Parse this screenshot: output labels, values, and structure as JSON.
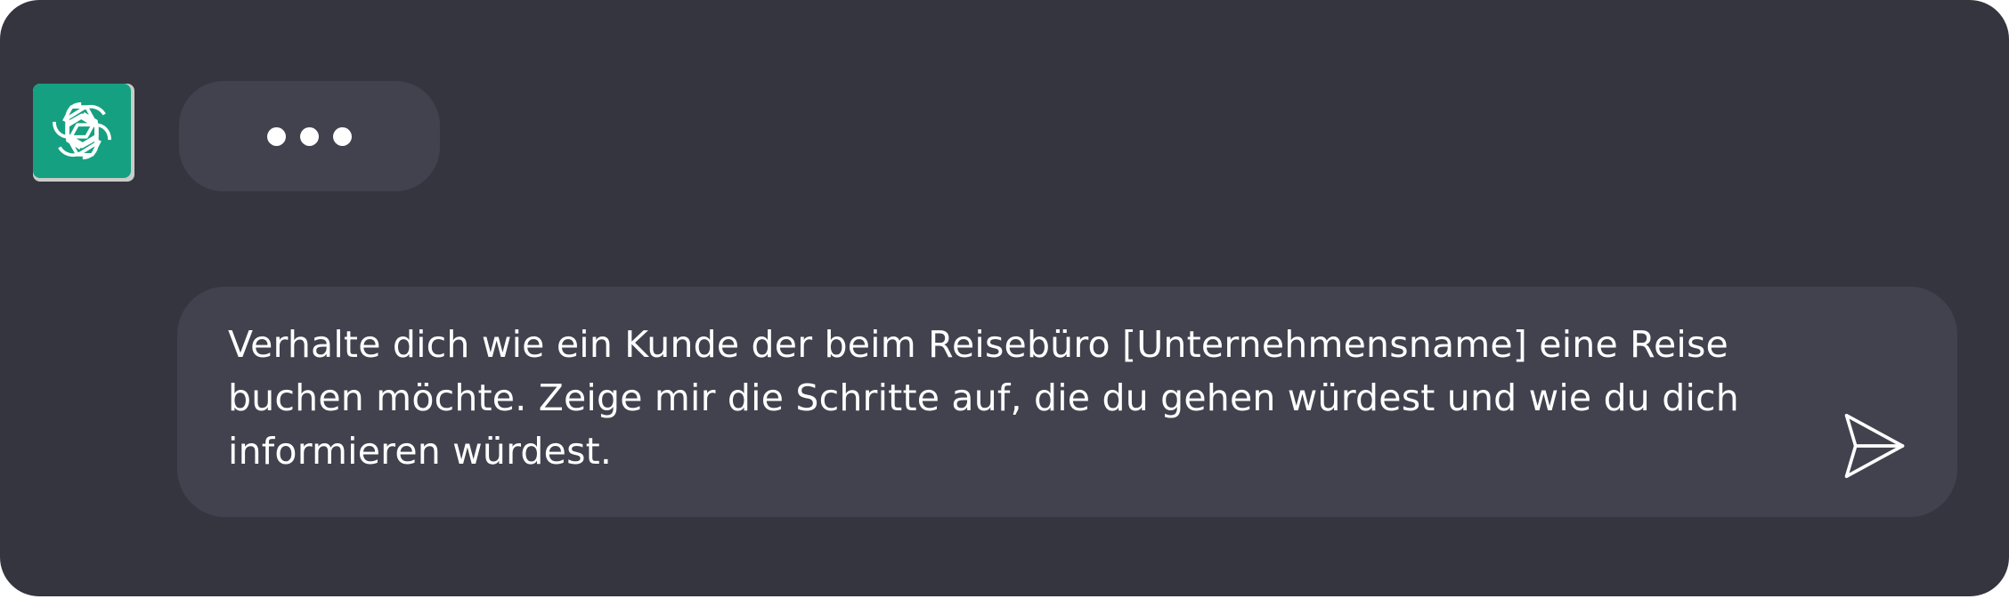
{
  "assistant": {
    "avatar_icon": "openai-logo-icon",
    "avatar_color": "#15A181",
    "status_indicator": "typing"
  },
  "composer": {
    "prompt_text": "Verhalte dich wie ein Kunde der beim Reisebüro [Unternehmensname] eine Reise buchen möchte. Zeige mir die Schritte auf, die du gehen würdest und wie du dich informieren würdest.",
    "send_icon": "send-icon"
  },
  "colors": {
    "background": "#353540",
    "surface": "#41424E",
    "text": "#FFFFFF",
    "accent": "#15A181"
  }
}
